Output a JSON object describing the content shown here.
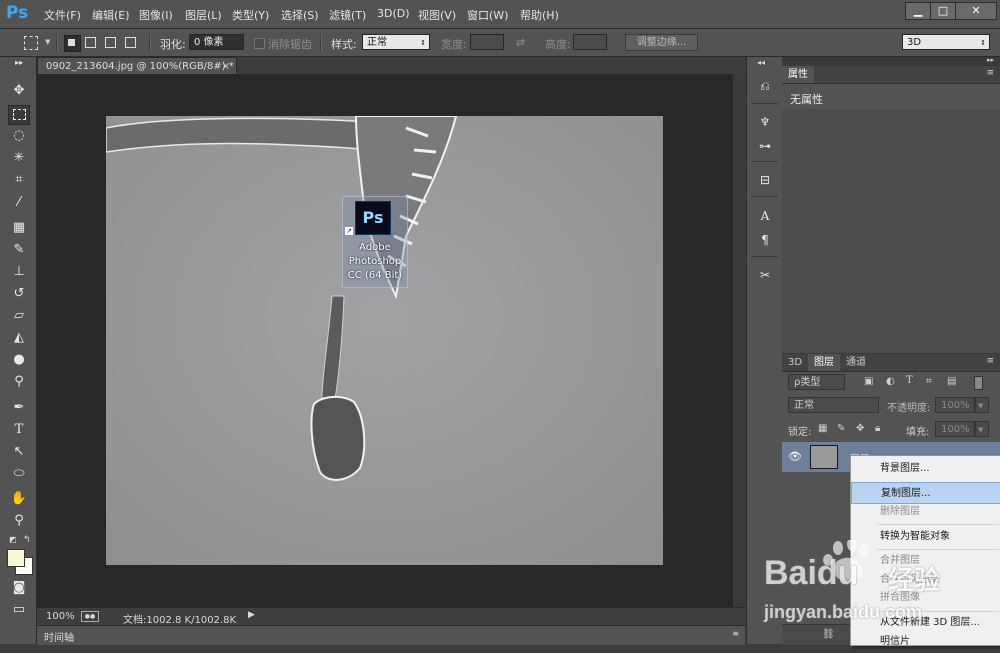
{
  "app": {
    "logo": "Ps"
  },
  "menu": [
    "文件(F)",
    "编辑(E)",
    "图像(I)",
    "图层(L)",
    "类型(Y)",
    "选择(S)",
    "滤镜(T)",
    "3D(D)",
    "视图(V)",
    "窗口(W)",
    "帮助(H)"
  ],
  "window_controls": {
    "minimize": "▁",
    "maximize": "□",
    "close": "✕"
  },
  "options": {
    "feather_label": "羽化:",
    "feather_value": "0 像素",
    "antialias_label": "消除锯齿",
    "style_label": "样式:",
    "style_value": "正常",
    "width_label": "宽度:",
    "height_label": "高度:",
    "refine_edge": "调整边缘...",
    "workspace": "3D"
  },
  "document": {
    "tab_title": "0902_213604.jpg @ 100%(RGB/8#) *",
    "tab_close": "×",
    "zoom": "100%",
    "doc_info": "文档:1002.8 K/1002.8K"
  },
  "timeline": {
    "label": "时间轴"
  },
  "desktop_shortcut": {
    "icon_text": "Ps",
    "label_line1": "Adobe",
    "label_line2": "Photoshop",
    "label_line3": "CC (64 Bit)"
  },
  "properties_panel": {
    "tab": "属性",
    "content": "无属性"
  },
  "layers_panel": {
    "tabs": [
      "3D",
      "图层",
      "通道"
    ],
    "active_tab": "图层",
    "filter_label": "ρ类型",
    "blend_mode": "正常",
    "opacity_label": "不透明度:",
    "opacity_value": "100%",
    "lock_label": "锁定:",
    "fill_label": "填充:",
    "fill_value": "100%",
    "layer_name": "背景"
  },
  "context_menu": {
    "items": [
      {
        "label": "背景图层...",
        "disabled": false
      },
      {
        "label": "复制图层...",
        "disabled": false,
        "highlighted": true
      },
      {
        "label": "删除图层",
        "disabled": true
      },
      {
        "label": "转换为智能对象",
        "disabled": false
      },
      {
        "label": "合并图层",
        "disabled": true
      },
      {
        "label": "合并可见图层",
        "disabled": true
      },
      {
        "label": "拼合图像",
        "disabled": true
      },
      {
        "label": "从文件新建 3D 图层...",
        "disabled": false
      },
      {
        "label": "明信片",
        "disabled": false
      }
    ]
  },
  "watermark": {
    "brand": "Baidu",
    "brand_cn": "经验",
    "url": "jingyan.baidu.com"
  }
}
